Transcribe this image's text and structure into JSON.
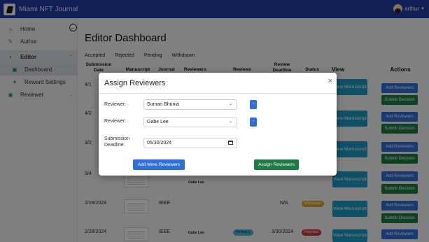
{
  "app": {
    "title": "Miami NFT Journal",
    "user": "arthur"
  },
  "sidebar": {
    "items": [
      {
        "label": "Home",
        "icon": "home-icon"
      },
      {
        "label": "Author",
        "icon": "edit-icon"
      },
      {
        "label": "Editor",
        "icon": "editor-icon"
      },
      {
        "label": "Dashboard",
        "icon": "dashboard-icon"
      },
      {
        "label": "Reward Settings",
        "icon": "reward-icon"
      },
      {
        "label": "Reviewer",
        "icon": "reviewer-icon"
      }
    ]
  },
  "page": {
    "title": "Editor Dashboard"
  },
  "tabs": [
    "Accepted",
    "Rejected",
    "Pending",
    "Withdrawn"
  ],
  "table": {
    "headers": [
      "Submission Date",
      "Manuscript",
      "Journal",
      "Reviewers",
      "Reviews",
      "Review Deadline",
      "Status",
      "View",
      "Actions"
    ],
    "rows": [
      {
        "date": "4/1",
        "journal": "",
        "reviewers": "",
        "deadline": "",
        "status": ""
      },
      {
        "date": "4/2",
        "journal": "",
        "reviewers": "",
        "deadline": "",
        "status": ""
      },
      {
        "date": "3/2",
        "journal": "",
        "reviewers": "",
        "deadline": "",
        "status": ""
      },
      {
        "date": "3/4",
        "journal": "",
        "reviewers": "Gabe Lee",
        "deadline": "",
        "status": ""
      },
      {
        "date": "2/28/2024",
        "journal": "IEEE",
        "reviewers": "",
        "deadline": "N/A",
        "status": "Withdrawn"
      },
      {
        "date": "2/28/2024",
        "journal": "IEEE",
        "reviewers": "Gabe Lee",
        "reviews": "Review 1",
        "deadline": "3/30/2024",
        "status": "Rejected"
      }
    ],
    "view_label": "View Manuscript",
    "add_reviewers_label": "Add Reviewers",
    "submit_decision_label": "Submit Decision"
  },
  "modal": {
    "title": "Assign Reviewers",
    "reviewer_label": "Reviewer:",
    "reviewers": [
      "Suman Bhunia",
      "Gabe Lee"
    ],
    "deadline_label": "Submission Deadline:",
    "deadline_value": "05/30/2024",
    "add_more_label": "Add More Reviewers",
    "assign_label": "Assign Reviewers",
    "minus_label": "-",
    "close": "×"
  },
  "colors": {
    "topbar": "#1f3fa5",
    "primary": "#2e6fd8",
    "success": "#1e7b46",
    "teal": "#1c9ac2",
    "withdrawn": "#e0a526",
    "rejected": "#c73b3b",
    "review_badge": "#4cb6d8"
  }
}
